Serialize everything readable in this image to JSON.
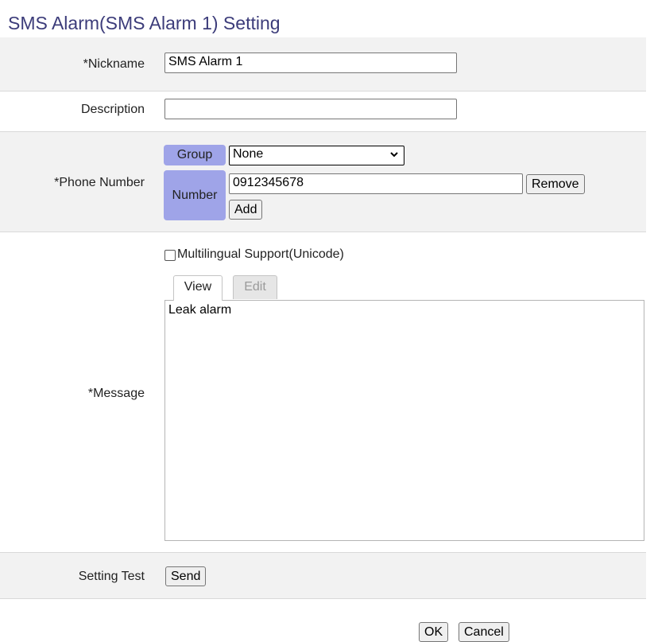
{
  "page_title": "SMS Alarm(SMS Alarm 1) Setting",
  "nickname": {
    "label": "*Nickname",
    "value": "SMS Alarm 1"
  },
  "description": {
    "label": "Description",
    "value": ""
  },
  "phone": {
    "label": "*Phone Number",
    "group_tag": "Group",
    "group_selected": "None",
    "number_tag": "Number",
    "number_value": "0912345678",
    "remove_label": "Remove",
    "add_label": "Add"
  },
  "message": {
    "label": "*Message",
    "multilingual_label": "Multilingual Support(Unicode)",
    "multilingual_checked": false,
    "tabs": [
      "View",
      "Edit"
    ],
    "active_tab": "View",
    "text": "Leak alarm"
  },
  "setting_test": {
    "label": "Setting Test",
    "send_label": "Send"
  },
  "footer": {
    "ok_label": "OK",
    "cancel_label": "Cancel"
  },
  "colors": {
    "title": "#3c3c7a",
    "tag_bg": "#9fa4e8",
    "row_shade": "#f2f2f2",
    "row_border": "#d9d9d9"
  }
}
